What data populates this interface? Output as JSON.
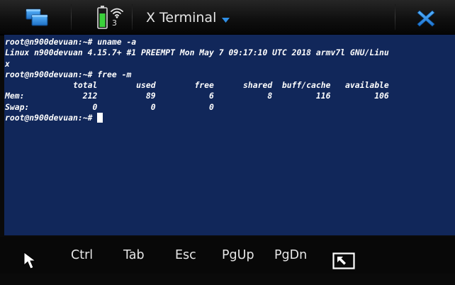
{
  "topbar": {
    "app_title": "X Terminal",
    "battery_count": "3",
    "icons": [
      "task-switcher-icon",
      "battery-icon",
      "wifi-icon",
      "dropdown-caret-icon",
      "close-icon"
    ]
  },
  "terminal": {
    "lines": [
      "root@n900devuan:~# uname -a",
      "Linux n900devuan 4.15.7+ #1 PREEMPT Mon May 7 09:17:10 UTC 2018 armv7l GNU/Linu",
      "x",
      "root@n900devuan:~# free -m",
      "              total        used        free      shared  buff/cache   available",
      "Mem:            212          89           6           8         116         106",
      "Swap:             0           0           0"
    ],
    "prompt": "root@n900devuan:~# ",
    "background": "#11275a",
    "foreground": "#ffffff"
  },
  "toolbar": {
    "keys": [
      "Ctrl",
      "Tab",
      "Esc",
      "PgUp",
      "PgDn"
    ],
    "icons": [
      "pointer-icon",
      "fullscreen-icon"
    ]
  },
  "colors": {
    "accent_blue": "#2f8fe6",
    "battery_green": "#3bd13b"
  }
}
